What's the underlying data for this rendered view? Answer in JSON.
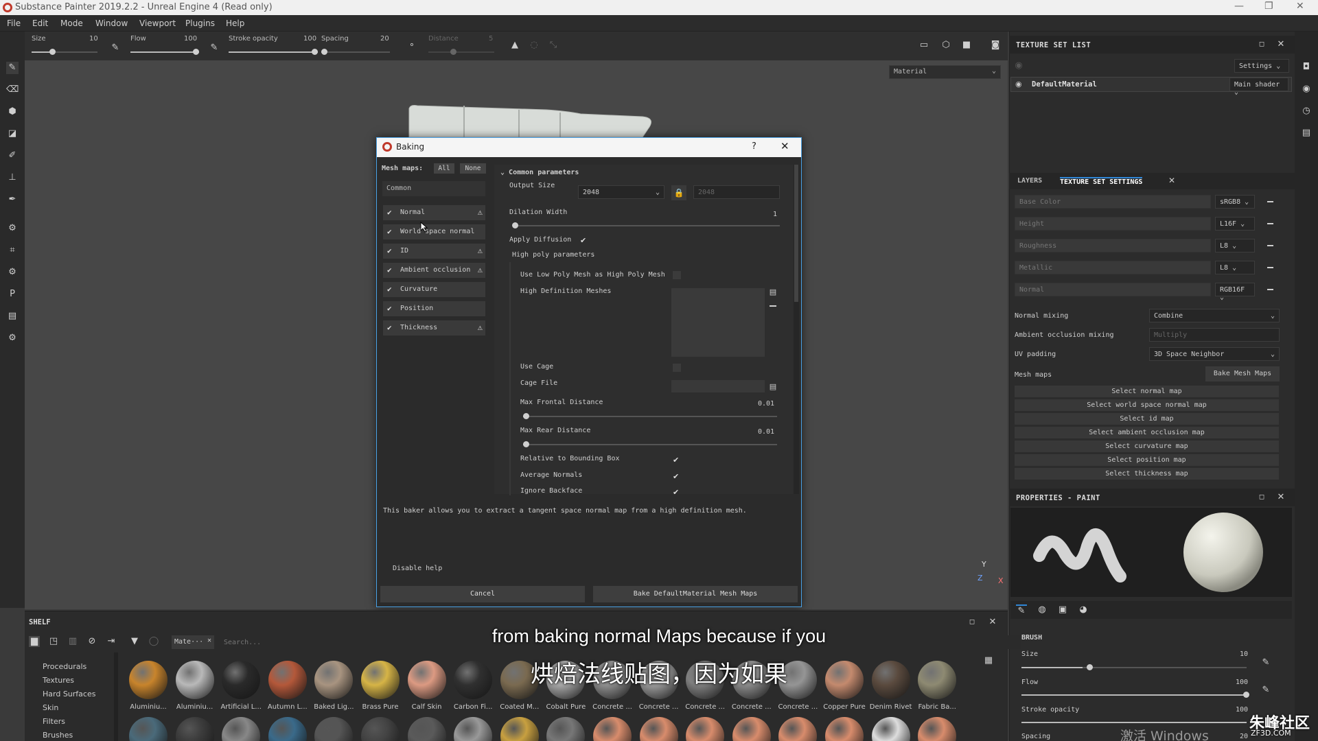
{
  "window": {
    "title": "Substance Painter 2019.2.2 - Unreal Engine 4 (Read only)",
    "controls": [
      "—",
      "❐",
      "✕"
    ]
  },
  "menu": [
    "File",
    "Edit",
    "Mode",
    "Window",
    "Viewport",
    "Plugins",
    "Help"
  ],
  "tool_options": {
    "size": {
      "label": "Size",
      "value": "10"
    },
    "flow": {
      "label": "Flow",
      "value": "100"
    },
    "stroke_opacity": {
      "label": "Stroke opacity",
      "value": "100"
    },
    "spacing": {
      "label": "Spacing",
      "value": "20"
    },
    "distance": {
      "label": "Distance",
      "value": "5"
    }
  },
  "viewport": {
    "material_dropdown": "Material",
    "axes": {
      "y": "Y",
      "z": "Z",
      "x": "X"
    }
  },
  "texture_set_list": {
    "title": "TEXTURE SET LIST",
    "settings_label": "Settings",
    "material": "DefaultMaterial",
    "shader": "Main shader"
  },
  "texture_set_settings": {
    "tabs": [
      "LAYERS",
      "TEXTURE SET SETTINGS"
    ],
    "channels": [
      {
        "name": "Base Color",
        "format": "sRGB8"
      },
      {
        "name": "Height",
        "format": "L16F"
      },
      {
        "name": "Roughness",
        "format": "L8"
      },
      {
        "name": "Metallic",
        "format": "L8"
      },
      {
        "name": "Normal",
        "format": "RGB16F"
      }
    ],
    "normal_mixing": {
      "label": "Normal mixing",
      "value": "Combine"
    },
    "ao_mixing": {
      "label": "Ambient occlusion mixing",
      "value": "Multiply"
    },
    "uv_padding": {
      "label": "UV padding",
      "value": "3D Space Neighbor"
    },
    "mesh_maps": {
      "label": "Mesh maps",
      "button": "Bake Mesh Maps"
    },
    "select_buttons": [
      "Select normal map",
      "Select world space normal map",
      "Select id map",
      "Select ambient occlusion map",
      "Select curvature map",
      "Select position map",
      "Select thickness map"
    ]
  },
  "properties": {
    "title": "PROPERTIES - PAINT",
    "brush_heading": "BRUSH",
    "size": {
      "label": "Size",
      "value": "10"
    },
    "flow": {
      "label": "Flow",
      "value": "100"
    },
    "stroke_opacity": {
      "label": "Stroke opacity",
      "value": "100"
    },
    "spacing": {
      "label": "Spacing",
      "value": "20"
    }
  },
  "baking": {
    "title": "Baking",
    "help": "?",
    "mesh_maps_label": "Mesh maps:",
    "all": "All",
    "none": "None",
    "common": "Common",
    "maps": [
      {
        "label": "Normal",
        "checked": true,
        "warning": true
      },
      {
        "label": "World space normal",
        "checked": true,
        "warning": false
      },
      {
        "label": "ID",
        "checked": true,
        "warning": true
      },
      {
        "label": "Ambient occlusion",
        "checked": true,
        "warning": true
      },
      {
        "label": "Curvature",
        "checked": true,
        "warning": false
      },
      {
        "label": "Position",
        "checked": true,
        "warning": false
      },
      {
        "label": "Thickness",
        "checked": true,
        "warning": true
      }
    ],
    "common_params": "Common parameters",
    "output_size": {
      "label": "Output Size",
      "value": "2048",
      "locked_value": "2048"
    },
    "dilation": {
      "label": "Dilation Width",
      "value": "1"
    },
    "apply_diffusion": "Apply Diffusion",
    "high_poly": "High poly parameters",
    "use_low_poly": "Use Low Poly Mesh as High Poly Mesh",
    "hd_meshes": "High Definition Meshes",
    "use_cage": "Use Cage",
    "cage_file": "Cage File",
    "max_frontal": {
      "label": "Max Frontal Distance",
      "value": "0.01"
    },
    "max_rear": {
      "label": "Max Rear Distance",
      "value": "0.01"
    },
    "relative_bbox": "Relative to Bounding Box",
    "average_normals": "Average Normals",
    "ignore_backface": "Ignore Backface",
    "help_text": "This baker allows you to extract a tangent space normal map from a high definition mesh.",
    "disable_help": "Disable help",
    "cancel": "Cancel",
    "bake": "Bake DefaultMaterial Mesh Maps"
  },
  "shelf": {
    "title": "SHELF",
    "filter_tag": "Mate···",
    "search_placeholder": "Search...",
    "categories": [
      "Procedurals",
      "Textures",
      "Hard Surfaces",
      "Skin",
      "Filters",
      "Brushes"
    ],
    "materials": [
      {
        "name": "Aluminiu...",
        "color": "#c8842c"
      },
      {
        "name": "Aluminiu...",
        "color": "#b9b9b9"
      },
      {
        "name": "Artificial L...",
        "color": "#2a2a2a"
      },
      {
        "name": "Autumn L...",
        "color": "#b4583a"
      },
      {
        "name": "Baked Lig...",
        "color": "#a89480"
      },
      {
        "name": "Brass Pure",
        "color": "#d6b446"
      },
      {
        "name": "Calf Skin",
        "color": "#dc9a82"
      },
      {
        "name": "Carbon Fi...",
        "color": "#303030"
      },
      {
        "name": "Coated M...",
        "color": "#7a6a50"
      },
      {
        "name": "Cobalt Pure",
        "color": "#a6a6a6"
      },
      {
        "name": "Concrete ...",
        "color": "#8e8e8e"
      },
      {
        "name": "Concrete ...",
        "color": "#9a9a9a"
      },
      {
        "name": "Concrete ...",
        "color": "#7f7f7f"
      },
      {
        "name": "Concrete ...",
        "color": "#8a8a8a"
      },
      {
        "name": "Concrete ...",
        "color": "#959595"
      },
      {
        "name": "Copper Pure",
        "color": "#c48a6e"
      },
      {
        "name": "Denim Rivet",
        "color": "#5a4a3e"
      },
      {
        "name": "Fabric Ba...",
        "color": "#8e8a72"
      }
    ]
  },
  "subtitles": {
    "english": "from baking normal Maps because if you",
    "chinese": "烘焙法线贴图，因为如果"
  },
  "watermark": {
    "windows": "激活 Windows",
    "site": "朱峰社区",
    "domain": "ZF3D.COM"
  }
}
